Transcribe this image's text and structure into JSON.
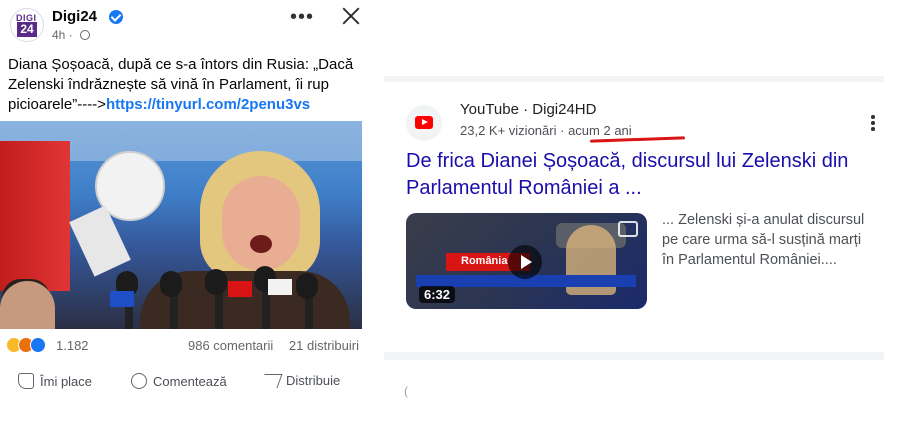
{
  "facebook_post": {
    "page_name": "Digi24",
    "logo_text": "DIGI 24",
    "time_ago": "4h",
    "dot": "·",
    "text": "Diana Șoșoacă, după ce s-a întors din Rusia: „Dacă Zelenski îndrăznește să vină în Parlament, îi rup picioarele”---->",
    "link": "https://tinyurl.com/2penu3vs",
    "reactions_count": "1.182",
    "comments": "986 comentarii",
    "shares": "21 distribuiri",
    "actions": {
      "like": "Îmi place",
      "comment": "Comentează",
      "share": "Distribuie"
    },
    "icons": [
      "verified-badge-icon",
      "globe-icon",
      "more-options-icon",
      "close-icon",
      "haha-reaction-icon",
      "angry-reaction-icon",
      "like-reaction-icon",
      "thumbs-up-icon",
      "comment-icon",
      "share-icon"
    ]
  },
  "search_result": {
    "source": "YouTube · Digi24HD",
    "views": "23,2 K+ vizionări",
    "separator": "·",
    "age": "acum 2 ani",
    "title": "De frica Dianei Șoșoacă, discursul lui Zelenski din Parlamentul României a ...",
    "thumbnail": {
      "duration": "6:32",
      "tag": "România"
    },
    "snippet": "... Zelenski și-a anulat discursul pe care urma să-l susțină marți în Parlamentul României....",
    "accent_underline_color": "#d81414",
    "link_color": "#1a0dab"
  },
  "footer_glyph": "("
}
